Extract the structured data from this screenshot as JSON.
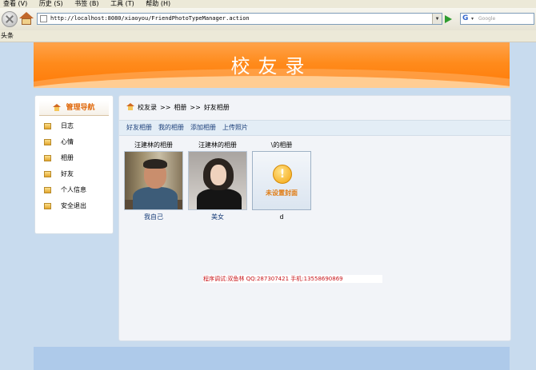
{
  "browser": {
    "menu": [
      "查看 (V)",
      "历史 (S)",
      "书签 (B)",
      "工具 (T)",
      "帮助 (H)"
    ],
    "url": "http://localhost:8080/xiaoyou/FriendPhotoTypeManager.action",
    "search_placeholder": "Google",
    "search_engine_glyph": "G",
    "bookmark_bar_label": "头条",
    "icons": [
      "stop-icon",
      "home-icon",
      "page-icon",
      "dropdown-icon",
      "go-icon",
      "google-icon"
    ]
  },
  "header": {
    "title": "校友录"
  },
  "sidebar": {
    "title": "管理导航",
    "items": [
      {
        "label": "日志"
      },
      {
        "label": "心情"
      },
      {
        "label": "相册"
      },
      {
        "label": "好友"
      },
      {
        "label": "个人信息"
      },
      {
        "label": "安全退出"
      }
    ]
  },
  "content": {
    "breadcrumb": [
      "校友录",
      "相册",
      "好友相册"
    ],
    "breadcrumb_sep": ">>",
    "tabs": [
      "好友相册",
      "我的相册",
      "添加相册",
      "上传照片"
    ],
    "albums": [
      {
        "owner": "汪建林的相册",
        "caption": "我自己",
        "cover": "photo"
      },
      {
        "owner": "汪建林的相册",
        "caption": "美女",
        "cover": "photo"
      },
      {
        "owner": "\\的相册",
        "caption": "d",
        "cover": "placeholder",
        "placeholder_text": "未设置封面"
      }
    ],
    "debug_text": "程序调试:双鱼林 QQ:287307421 手机:13558690869"
  },
  "colors": {
    "banner_orange": "#ff8b1c",
    "sidebar_title": "#e06a0e",
    "link_blue": "#1b3f7a",
    "debug_red": "#c8151a",
    "page_bg": "#c8dbee"
  }
}
